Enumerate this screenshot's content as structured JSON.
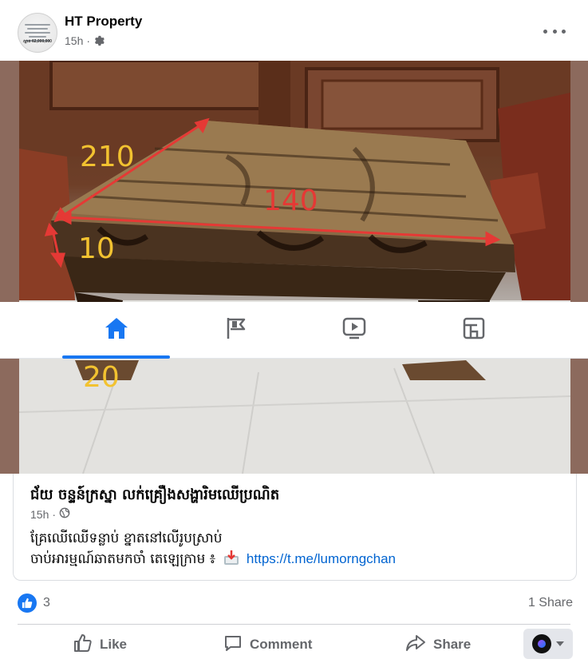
{
  "post": {
    "author": "HT Property",
    "time": "15h",
    "avatar_text": "ស្អាត 62,000,000"
  },
  "photo": {
    "dimension_labels": [
      "210",
      "140",
      "10",
      "20"
    ],
    "label_colors": {
      "yellow": "#f2c230",
      "red": "#e53935"
    }
  },
  "tabbar": {
    "tabs": [
      {
        "name": "home",
        "icon": "home-icon",
        "active": true
      },
      {
        "name": "pages",
        "icon": "flag-icon",
        "active": false
      },
      {
        "name": "video",
        "icon": "video-icon",
        "active": false
      },
      {
        "name": "feeds",
        "icon": "feeds-icon",
        "active": false
      }
    ]
  },
  "link_card": {
    "title": "ជ័យ ចន្ទន៍ក្រស្នា លក់គ្រឿងសង្ហារិមឈើប្រណិត",
    "time": "15h",
    "line1": "គ្រែឈើឈើទន្លាប់ ខ្នាតនៅលើរូបស្រាប់",
    "line2": "ចាប់អារម្មណ៍ឆាតមកចាំ តេឡេក្រាម ៖",
    "link": "https://t.me/lumorngchan"
  },
  "stats": {
    "like_count": "3",
    "share_count": "1 Share"
  },
  "actions": {
    "like": "Like",
    "comment": "Comment",
    "share": "Share"
  },
  "colors": {
    "accent": "#1877f2",
    "link": "#0064d1",
    "muted": "#65676b"
  }
}
